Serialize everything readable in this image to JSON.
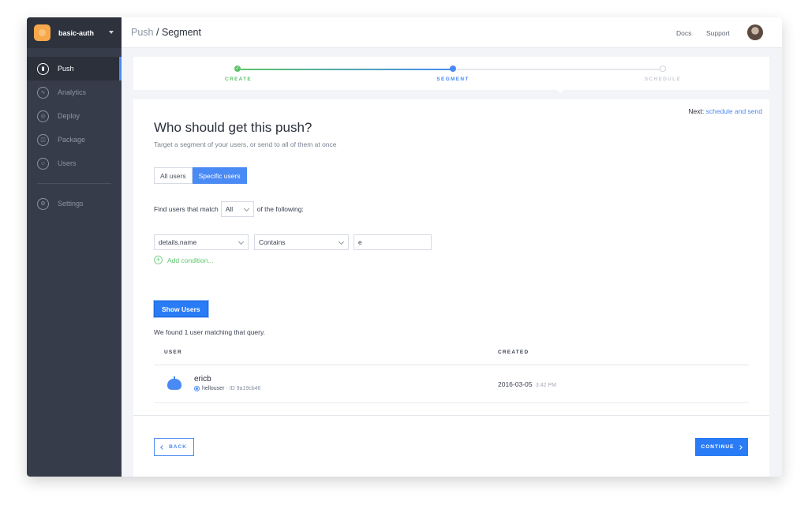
{
  "app": {
    "name": "basic-auth"
  },
  "sidebar": {
    "items": [
      {
        "label": "Push",
        "icon": "push-icon",
        "active": true
      },
      {
        "label": "Analytics",
        "icon": "analytics-icon"
      },
      {
        "label": "Deploy",
        "icon": "deploy-icon"
      },
      {
        "label": "Package",
        "icon": "package-icon"
      },
      {
        "label": "Users",
        "icon": "users-icon"
      },
      {
        "label": "Settings",
        "icon": "settings-icon"
      }
    ]
  },
  "header": {
    "breadcrumb_parent": "Push",
    "breadcrumb_sep": "/",
    "breadcrumb_current": "Segment",
    "docs": "Docs",
    "support": "Support"
  },
  "stepper": {
    "steps": [
      {
        "label": "CREATE",
        "state": "complete"
      },
      {
        "label": "SEGMENT",
        "state": "current"
      },
      {
        "label": "SCHEDULE",
        "state": "upcoming"
      }
    ]
  },
  "main": {
    "next_prefix": "Next:",
    "next_link": "schedule and send",
    "title": "Who should get this push?",
    "subtitle": "Target a segment of your users, or send to all of them at once",
    "segment_options": [
      "All users",
      "Specific users"
    ],
    "segment_selected": "Specific users",
    "match_prefix": "Find users that match",
    "match_value": "All",
    "match_suffix": "of the following:",
    "condition": {
      "field": "details.name",
      "operator": "Contains",
      "value": "e"
    },
    "add_condition": "Add condition...",
    "show_users": "Show Users",
    "found_text": "We found 1 user matching that query.",
    "table": {
      "headers": [
        "USER",
        "CREATED"
      ],
      "rows": [
        {
          "name": "ericb",
          "app": "hellouser",
          "id_text": "· ID 9a19cb46",
          "created_date": "2016-03-05",
          "created_time": "3:42 PM"
        }
      ]
    },
    "back": "BACK",
    "continue": "CONTINUE"
  },
  "colors": {
    "accent": "#4a8af4",
    "success": "#5cc36a",
    "sidebar": "#363c4a",
    "brand": "#f7a84a"
  }
}
